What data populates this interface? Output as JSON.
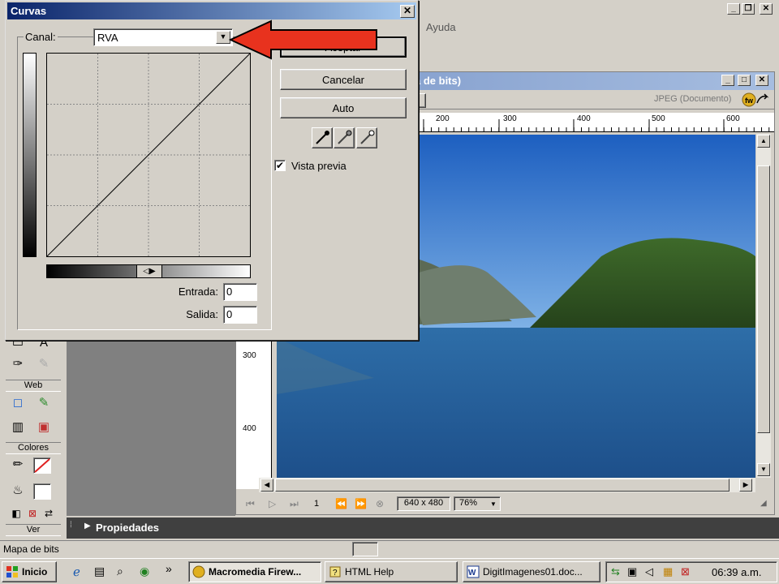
{
  "app": {
    "menu_help": "Ayuda"
  },
  "dialog": {
    "title": "Curvas",
    "close": "✕",
    "channel_label": "Canal:",
    "channel_value": "RVA",
    "ok_label": "Aceptar",
    "cancel_label": "Cancelar",
    "auto_label": "Auto",
    "preview_label": "Vista previa",
    "preview_checked": true,
    "input_label": "Entrada:",
    "input_value": "0",
    "output_label": "Salida:",
    "output_value": "0",
    "graph_arrows": "◁▶"
  },
  "document": {
    "title": "a de bits)",
    "format": "JPEG (Documento)",
    "hruler_ticks": [
      "200",
      "300",
      "400",
      "500",
      "600"
    ],
    "vruler_ticks": [
      "300",
      "400"
    ],
    "page": "1",
    "size": "640 x 480",
    "zoom": "76%"
  },
  "tools": {
    "web_label": "Web",
    "colors_label": "Colores",
    "view_label": "Ver"
  },
  "properties": {
    "label": "Propiedades"
  },
  "status": {
    "text": "Mapa de bits"
  },
  "taskbar": {
    "start": "Inicio",
    "chevron": "»",
    "tasks": [
      "Macromedia Firew...",
      "HTML Help",
      "DigitImagenes01.doc..."
    ],
    "clock": "06:39 a.m."
  },
  "colors": {
    "annotation_arrow": "#e8321e",
    "dialog_title_bg": "#0a246a"
  }
}
